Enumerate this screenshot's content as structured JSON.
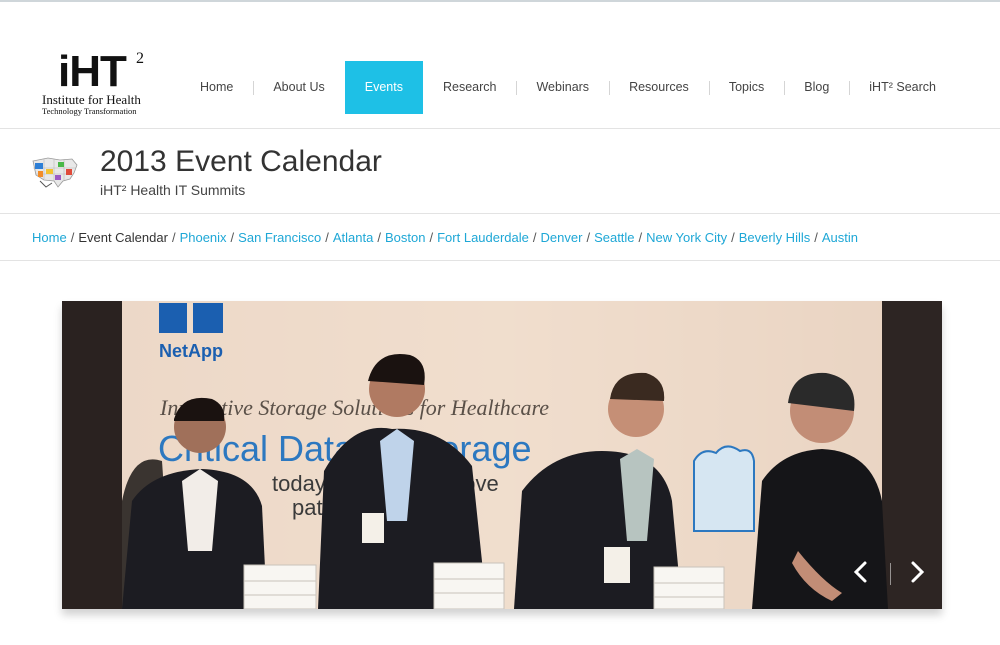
{
  "logo": {
    "main": "iHT",
    "sup": "2",
    "line1": "Institute for Health",
    "line2": "Technology Transformation"
  },
  "nav": {
    "items": [
      {
        "label": "Home"
      },
      {
        "label": "About Us"
      },
      {
        "label": "Events",
        "active": true
      },
      {
        "label": "Research"
      },
      {
        "label": "Webinars"
      },
      {
        "label": "Resources"
      },
      {
        "label": "Topics"
      },
      {
        "label": "Blog"
      },
      {
        "label": "iHT² Search"
      }
    ],
    "active_color": "#1ec0e6"
  },
  "page": {
    "title": "2013 Event Calendar",
    "subtitle": "iHT² Health IT Summits",
    "icon": "us-map-icon"
  },
  "breadcrumb": {
    "home": "Home",
    "current": "Event Calendar",
    "cities": [
      "Phoenix",
      "San Francisco",
      "Atlanta",
      "Boston",
      "Fort Lauderdale",
      "Denver",
      "Seattle",
      "New York City",
      "Beverly Hills",
      "Austin"
    ],
    "link_color": "#1ea7d6"
  },
  "slider": {
    "brand": "NetApp",
    "banner_line1": "Innovative Storage Solutions for Healthcare",
    "banner_line2": "Critical Data IT Storage",
    "banner_line3": "today's data ... improve",
    "banner_line4": "patient ... IT c",
    "prev_icon": "chevron-left-icon",
    "next_icon": "chevron-right-icon"
  }
}
